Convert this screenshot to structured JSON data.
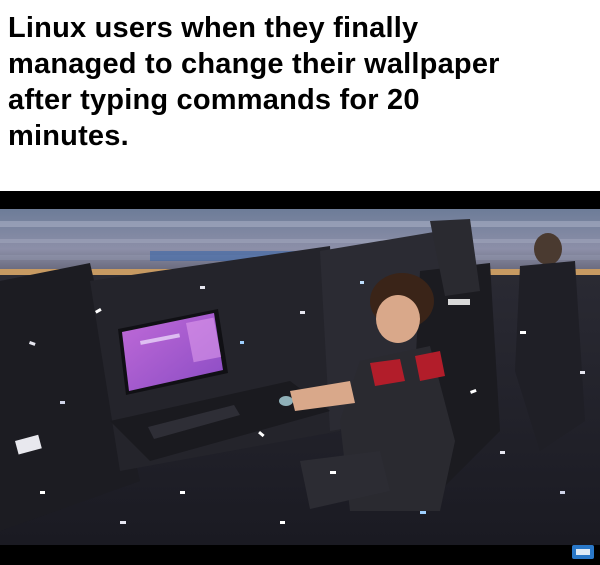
{
  "caption": {
    "lines": [
      "Linux users when they finally",
      "managed to change their wallpaper",
      "after typing commands for 20",
      "minutes."
    ]
  },
  "photo": {
    "icons": {
      "corner_badge": "channel-badge-icon"
    }
  }
}
